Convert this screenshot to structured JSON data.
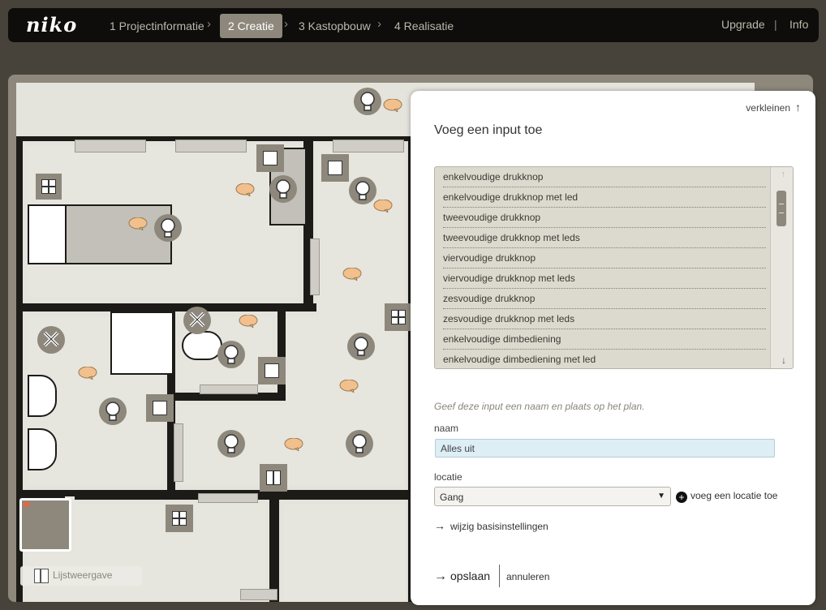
{
  "brand": {
    "logo": "niko"
  },
  "nav": {
    "steps": [
      {
        "label": "1 Projectinformatie",
        "active": false
      },
      {
        "label": "2 Creatie",
        "active": true
      },
      {
        "label": "3 Kastopbouw",
        "active": false
      },
      {
        "label": "4 Realisatie",
        "active": false
      }
    ],
    "upgrade": "Upgrade",
    "info": "Info"
  },
  "plan": {
    "list_view_label": "Lijstweergave"
  },
  "panel": {
    "shrink_label": "verkleinen",
    "title": "Voeg een input toe",
    "inputs": [
      "enkelvoudige drukknop",
      "enkelvoudige drukknop met led",
      "tweevoudige drukknop",
      "tweevoudige drukknop met leds",
      "viervoudige drukknop",
      "viervoudige drukknop met leds",
      "zesvoudige drukknop",
      "zesvoudige drukknop met leds",
      "enkelvoudige dimbediening",
      "enkelvoudige dimbediening met led"
    ],
    "hint": "Geef deze input een naam en plaats op het plan.",
    "name_label": "naam",
    "name_value": "Alles uit",
    "location_label": "locatie",
    "location_value": "Gang",
    "add_location": "voeg een locatie toe",
    "basic_settings": "wijzig basisinstellingen",
    "save": "opslaan",
    "cancel": "annuleren"
  },
  "colors": {
    "nav_bg": "#0e0d0b",
    "active_step": "#8d887b",
    "frame": "#8d887b",
    "list_bg": "#dcd9ce",
    "bubble": "#f2c08c",
    "name_input_bg": "#ddeef5"
  }
}
